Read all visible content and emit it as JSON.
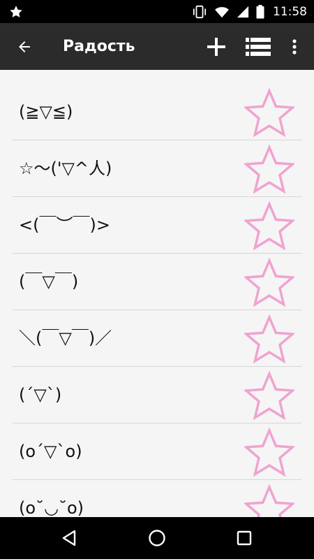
{
  "status_bar": {
    "time": "11:58",
    "icons": [
      "star-notification-icon",
      "vibrate-icon",
      "wifi-icon",
      "signal-icon",
      "battery-icon"
    ]
  },
  "app_bar": {
    "title": "Радость",
    "icons": [
      "back-arrow-icon",
      "plus-icon",
      "list-view-icon",
      "more-vert-icon"
    ]
  },
  "colors": {
    "status_bar": "#000000",
    "app_bar": "#2b2b2b",
    "background": "#f5f5f5",
    "star_outline": "#f0a3cf",
    "divider": "#d6d6d6"
  },
  "list": {
    "items": [
      {
        "text": "(≧▽≦)",
        "favorite": false
      },
      {
        "text": "☆〜('▽^人)",
        "favorite": false
      },
      {
        "text": "<(￣︶￣)>",
        "favorite": false
      },
      {
        "text": "(￣▽￣)",
        "favorite": false
      },
      {
        "text": "＼(￣▽￣)／",
        "favorite": false
      },
      {
        "text": "(´▽`)",
        "favorite": false
      },
      {
        "text": "(o´▽`o)",
        "favorite": false
      },
      {
        "text": "(o˘◡˘o)",
        "favorite": false
      }
    ]
  },
  "nav_bar": {
    "icons": [
      "back-triangle-icon",
      "home-circle-icon",
      "recents-square-icon"
    ]
  }
}
